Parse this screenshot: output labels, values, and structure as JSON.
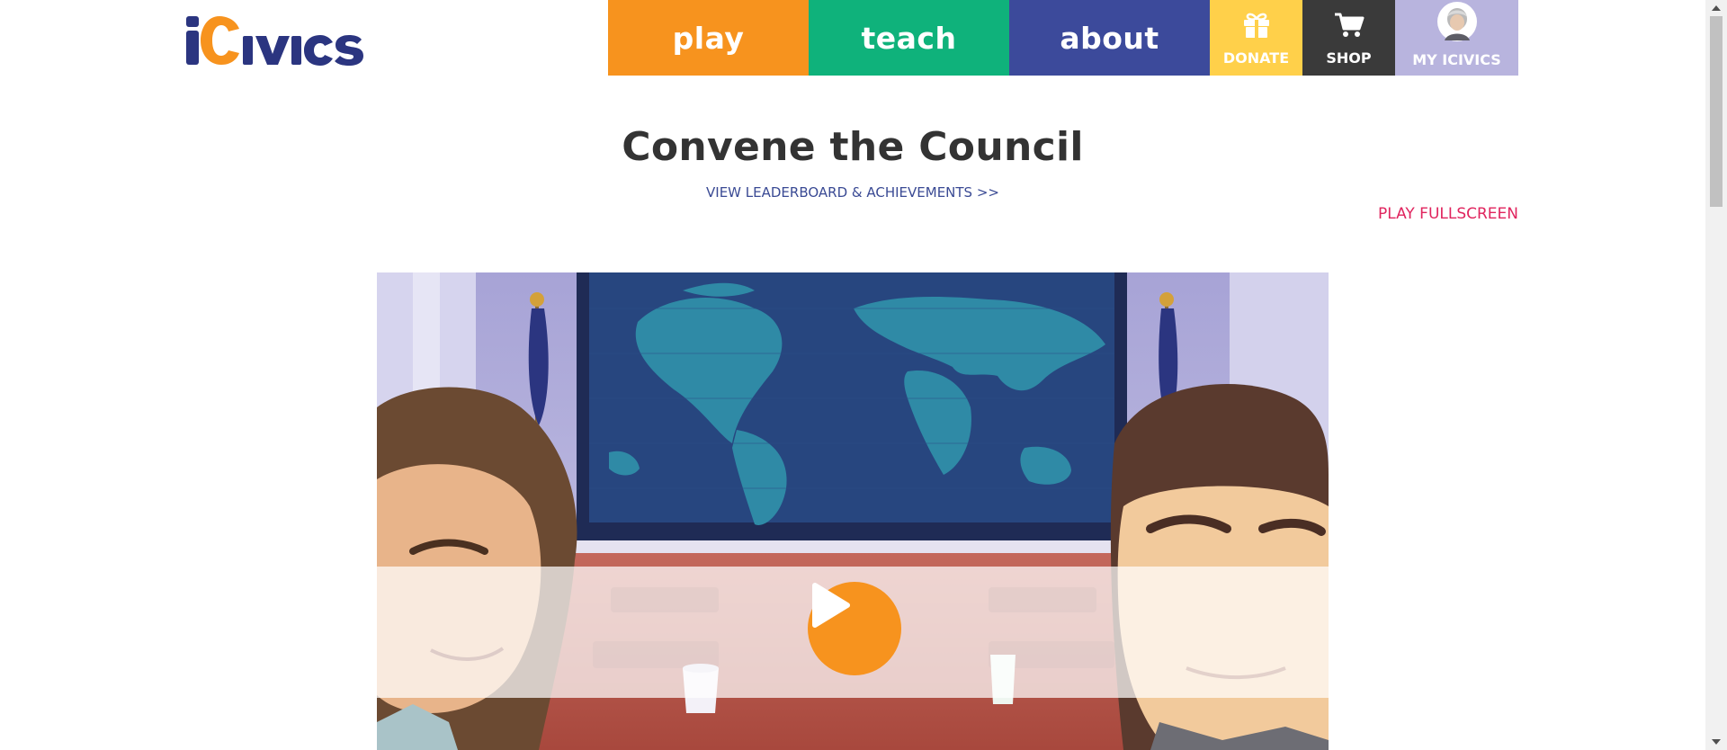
{
  "header": {
    "logo_text": "iCivics",
    "nav": {
      "play": "play",
      "teach": "teach",
      "about": "about",
      "donate": "DONATE",
      "shop": "SHOP",
      "my_icivics": "MY ICIVICS"
    },
    "colors": {
      "play": "#f7931e",
      "teach": "#0fb27b",
      "about": "#3c4a9b",
      "donate": "#ffd04a",
      "shop": "#3a3a3a",
      "my_icivics": "#b8b4de"
    },
    "icons": {
      "donate": "gift-icon",
      "shop": "cart-icon",
      "my_icivics": "avatar"
    }
  },
  "game": {
    "title": "Convene the Council",
    "leaderboard_link": "VIEW LEADERBOARD & ACHIEVEMENTS >>",
    "fullscreen_link": "PLAY FULLSCREEN",
    "play_icon": "play-icon"
  }
}
